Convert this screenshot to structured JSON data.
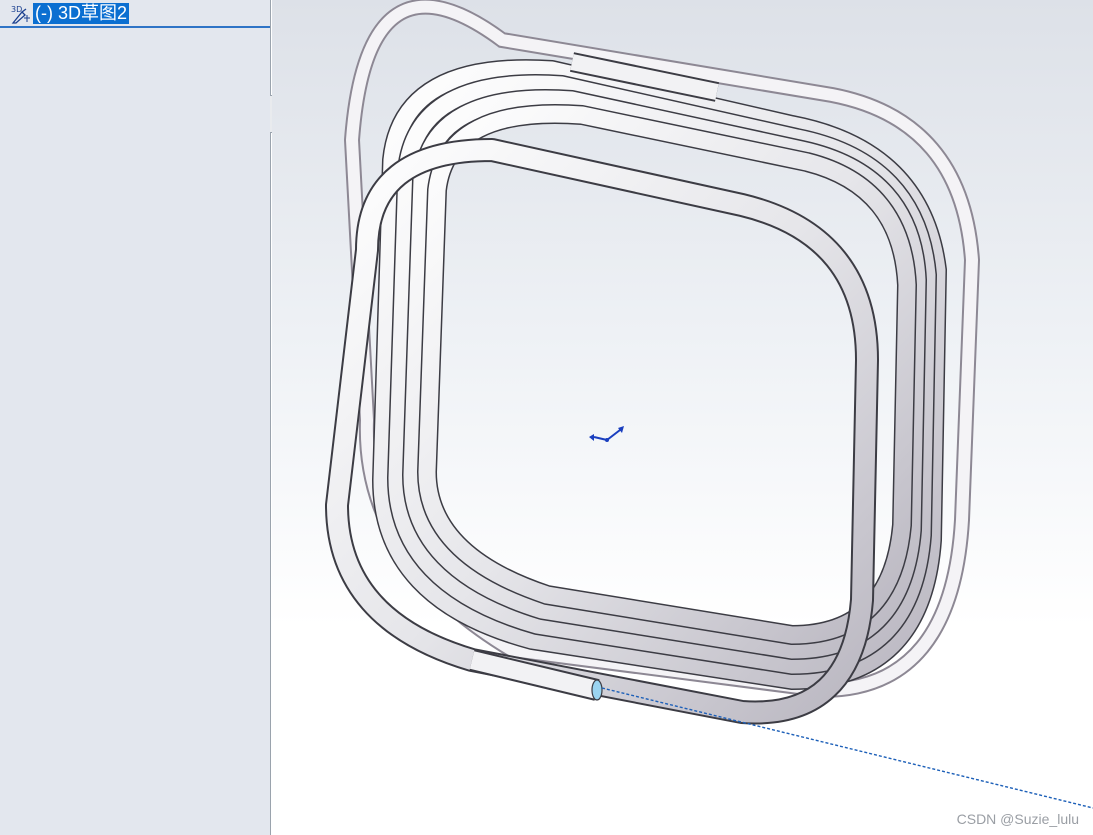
{
  "feature_tree": {
    "selected_item": {
      "icon": "3d-sketch-icon",
      "icon_text": "3D",
      "label": "(-) 3D草图2"
    }
  },
  "watermark": "CSDN @Suzie_lulu"
}
